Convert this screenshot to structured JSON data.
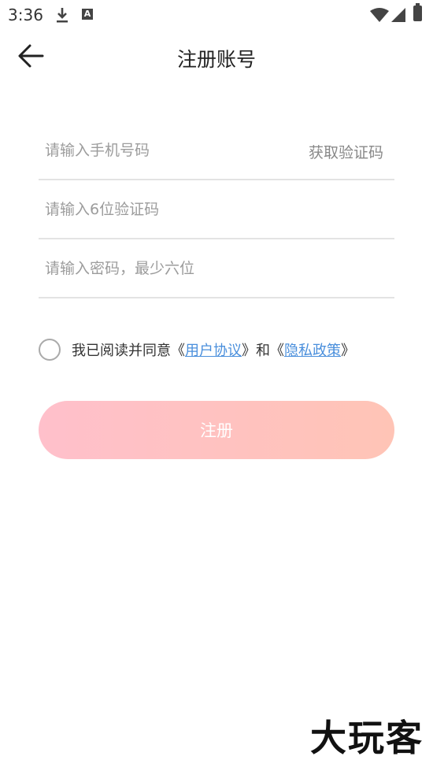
{
  "status_bar": {
    "time": "3:36",
    "download_icon": "download-icon",
    "a_icon": "A"
  },
  "header": {
    "title": "注册账号",
    "back_icon": "arrow-left-icon"
  },
  "form": {
    "phone_placeholder": "请输入手机号码",
    "get_code_label": "获取验证码",
    "code_placeholder": "请输入6位验证码",
    "password_placeholder": "请输入密码，最少六位"
  },
  "agreement": {
    "prefix": "我已阅读并同意《",
    "user_agreement": "用户协议",
    "middle": "》和《",
    "privacy_policy": "隐私政策",
    "suffix": "》",
    "checked": false
  },
  "register_label": "注册",
  "watermark": "大玩客",
  "colors": {
    "button_start": "#ffc0cb",
    "button_end": "#ffc4b6",
    "link": "#4a8fdc"
  }
}
